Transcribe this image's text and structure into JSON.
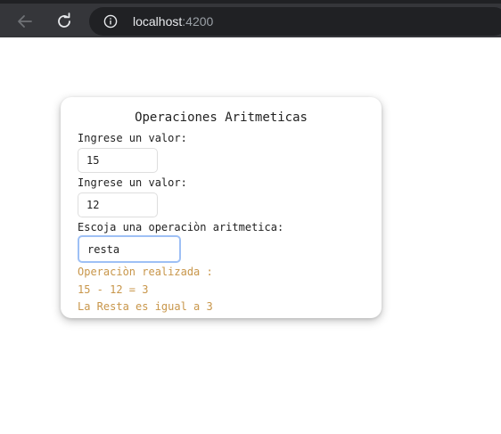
{
  "browser": {
    "url_host": "localhost",
    "url_port": ":4200"
  },
  "card": {
    "title": "Operaciones Aritmeticas",
    "label_value_1": "Ingrese un valor:",
    "value_1": "15",
    "label_value_2": "Ingrese un valor:",
    "value_2": "12",
    "label_operation": "Escoja una operaciòn aritmetica:",
    "operation": "resta",
    "result_heading": "Operaciòn realizada :",
    "result_expression": "15 - 12 = 3",
    "result_sentence": "La Resta es igual a 3"
  },
  "colors": {
    "toolbar": "#35363a",
    "result_text": "#c8964a",
    "focus_border": "#9ec0f5"
  },
  "icons": [
    "back-arrow-icon",
    "reload-icon",
    "info-icon"
  ]
}
